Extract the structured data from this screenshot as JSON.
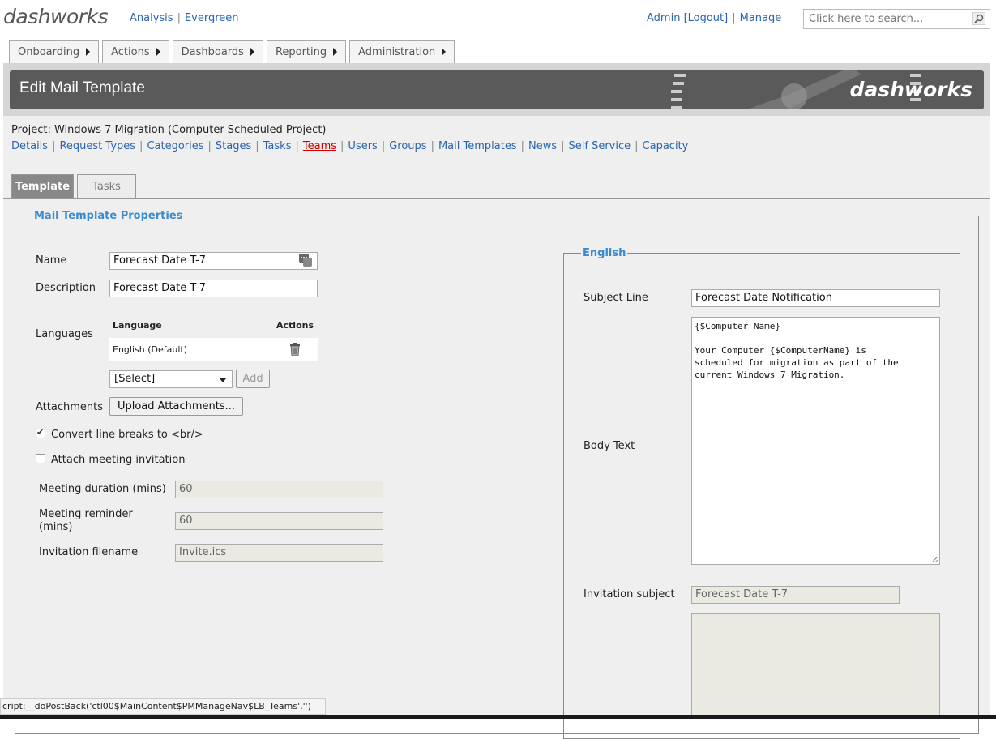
{
  "header": {
    "logo_text": "dashworks",
    "top_links": [
      "Analysis",
      "Evergreen"
    ],
    "admin_link": "Admin [Logout]",
    "manage_link": "Manage",
    "search_placeholder": "Click here to search..."
  },
  "nav": {
    "items": [
      "Onboarding",
      "Actions",
      "Dashboards",
      "Reporting",
      "Administration"
    ]
  },
  "banner": {
    "title": "Edit Mail Template",
    "logo_text": "dashworks"
  },
  "project": {
    "title": "Project: Windows 7 Migration (Computer Scheduled Project)",
    "links": [
      "Details",
      "Request Types",
      "Categories",
      "Stages",
      "Tasks",
      "Teams",
      "Users",
      "Groups",
      "Mail Templates",
      "News",
      "Self Service",
      "Capacity"
    ],
    "active_link": "Teams"
  },
  "tabs": {
    "template": "Template",
    "tasks": "Tasks"
  },
  "properties": {
    "legend": "Mail Template Properties",
    "name_label": "Name",
    "name_value": "Forecast Date T-7",
    "description_label": "Description",
    "description_value": "Forecast Date T-7",
    "languages_label": "Languages",
    "lang_col_language": "Language",
    "lang_col_actions": "Actions",
    "lang_row_language": "English (Default)",
    "lang_select_value": "[Select]",
    "add_button": "Add",
    "attachments_label": "Attachments",
    "upload_button": "Upload Attachments...",
    "convert_label": "Convert line breaks to <br/>",
    "convert_checked": true,
    "attach_meeting_label": "Attach meeting invitation",
    "attach_meeting_checked": false,
    "meeting_duration_label": "Meeting duration (mins)",
    "meeting_duration_value": "60",
    "meeting_reminder_label": "Meeting reminder (mins)",
    "meeting_reminder_value": "60",
    "invitation_filename_label": "Invitation filename",
    "invitation_filename_value": "Invite.ics"
  },
  "english": {
    "legend": "English",
    "subject_label": "Subject Line",
    "subject_value": "Forecast Date Notification",
    "body_label": "Body Text",
    "body_value": "{$Computer Name}\n\nYour Computer {$ComputerName} is\nscheduled for migration as part of the\ncurrent Windows 7 Migration.",
    "invitation_subject_label": "Invitation subject",
    "invitation_subject_value": "Forecast Date T-7",
    "invitation_body_value": ""
  },
  "status_bar": {
    "text": "cript:__doPostBack('ctl00$MainContent$PMManageNav$LB_Teams','')"
  }
}
